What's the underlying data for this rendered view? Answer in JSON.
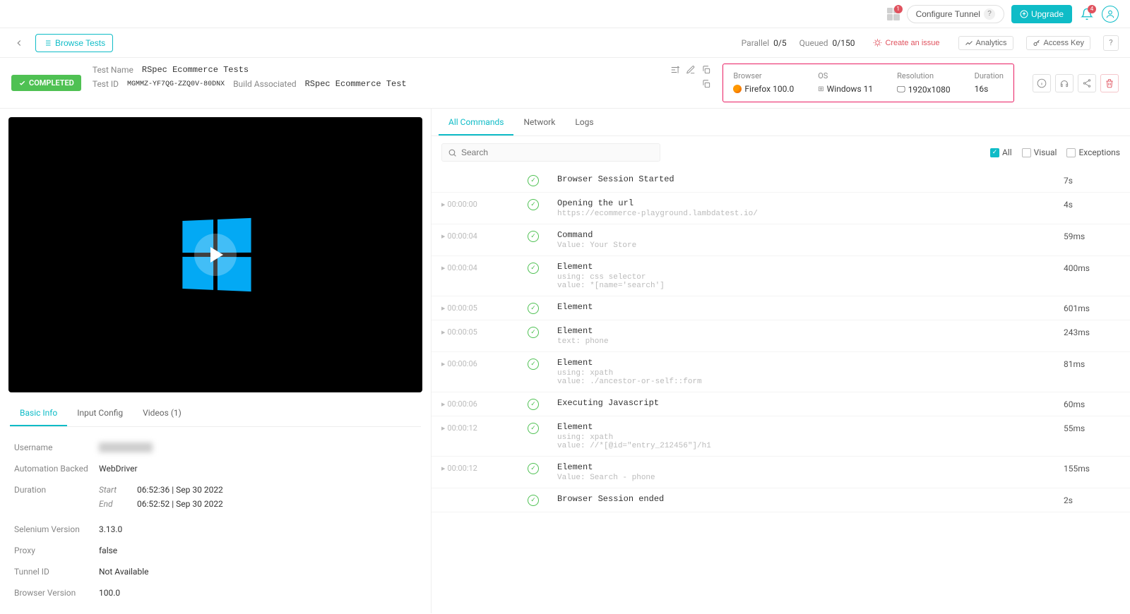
{
  "header": {
    "apps_badge": "1",
    "configure_tunnel": "Configure Tunnel",
    "upgrade": "Upgrade",
    "bell_badge": "4"
  },
  "subheader": {
    "browse_tests": "Browse Tests",
    "parallel_label": "Parallel",
    "parallel_value": "0/5",
    "queued_label": "Queued",
    "queued_value": "0/150",
    "create_issue": "Create an issue",
    "analytics": "Analytics",
    "access_key": "Access Key"
  },
  "test": {
    "completed": "COMPLETED",
    "name_label": "Test Name",
    "name_value": "RSpec Ecommerce Tests",
    "id_label": "Test ID",
    "id_value": "MGMMZ-YF7QG-ZZQ0V-80DNX",
    "build_label": "Build Associated",
    "build_value": "RSpec Ecommerce Test"
  },
  "env": {
    "browser_label": "Browser",
    "browser_value": "Firefox 100.0",
    "os_label": "OS",
    "os_value": "Windows 11",
    "res_label": "Resolution",
    "res_value": "1920x1080",
    "dur_label": "Duration",
    "dur_value": "16s"
  },
  "left_tabs": {
    "basic": "Basic Info",
    "input": "Input Config",
    "videos": "Videos (1)"
  },
  "basic_info": {
    "username_k": "Username",
    "username_v": "hidden",
    "automation_k": "Automation Backed",
    "automation_v": "WebDriver",
    "duration_k": "Duration",
    "start_k": "Start",
    "start_v": "06:52:36 | Sep 30 2022",
    "end_k": "End",
    "end_v": "06:52:52 | Sep 30 2022",
    "selenium_k": "Selenium Version",
    "selenium_v": "3.13.0",
    "proxy_k": "Proxy",
    "proxy_v": "false",
    "tunnel_k": "Tunnel ID",
    "tunnel_v": "Not Available",
    "browserver_k": "Browser Version",
    "browserver_v": "100.0"
  },
  "right_tabs": {
    "all_cmds": "All Commands",
    "network": "Network",
    "logs": "Logs"
  },
  "search": {
    "placeholder": "Search"
  },
  "filters": {
    "all": "All",
    "visual": "Visual",
    "exceptions": "Exceptions"
  },
  "commands": [
    {
      "time": "",
      "title": "Browser Session Started",
      "sub": "",
      "dur": "7s"
    },
    {
      "time": "00:00:00",
      "title": "Opening the url",
      "sub": "https://ecommerce-playground.lambdatest.io/",
      "dur": "4s"
    },
    {
      "time": "00:00:04",
      "title": "Command",
      "sub": "Value: Your Store",
      "dur": "59ms"
    },
    {
      "time": "00:00:04",
      "title": "Element",
      "sub": "using: css selector\nvalue: *[name='search']",
      "dur": "400ms"
    },
    {
      "time": "00:00:05",
      "title": "Element",
      "sub": "",
      "dur": "601ms"
    },
    {
      "time": "00:00:05",
      "title": "Element",
      "sub": "text: phone",
      "dur": "243ms"
    },
    {
      "time": "00:00:06",
      "title": "Element",
      "sub": "using: xpath\nvalue: ./ancestor-or-self::form",
      "dur": "81ms"
    },
    {
      "time": "00:00:06",
      "title": "Executing Javascript",
      "sub": "",
      "dur": "60ms"
    },
    {
      "time": "00:00:12",
      "title": "Element",
      "sub": "using: xpath\nvalue: //*[@id=\"entry_212456\"]/h1",
      "dur": "55ms"
    },
    {
      "time": "00:00:12",
      "title": "Element",
      "sub": "Value: Search - phone",
      "dur": "155ms"
    },
    {
      "time": "",
      "title": "Browser Session ended",
      "sub": "",
      "dur": "2s"
    }
  ]
}
